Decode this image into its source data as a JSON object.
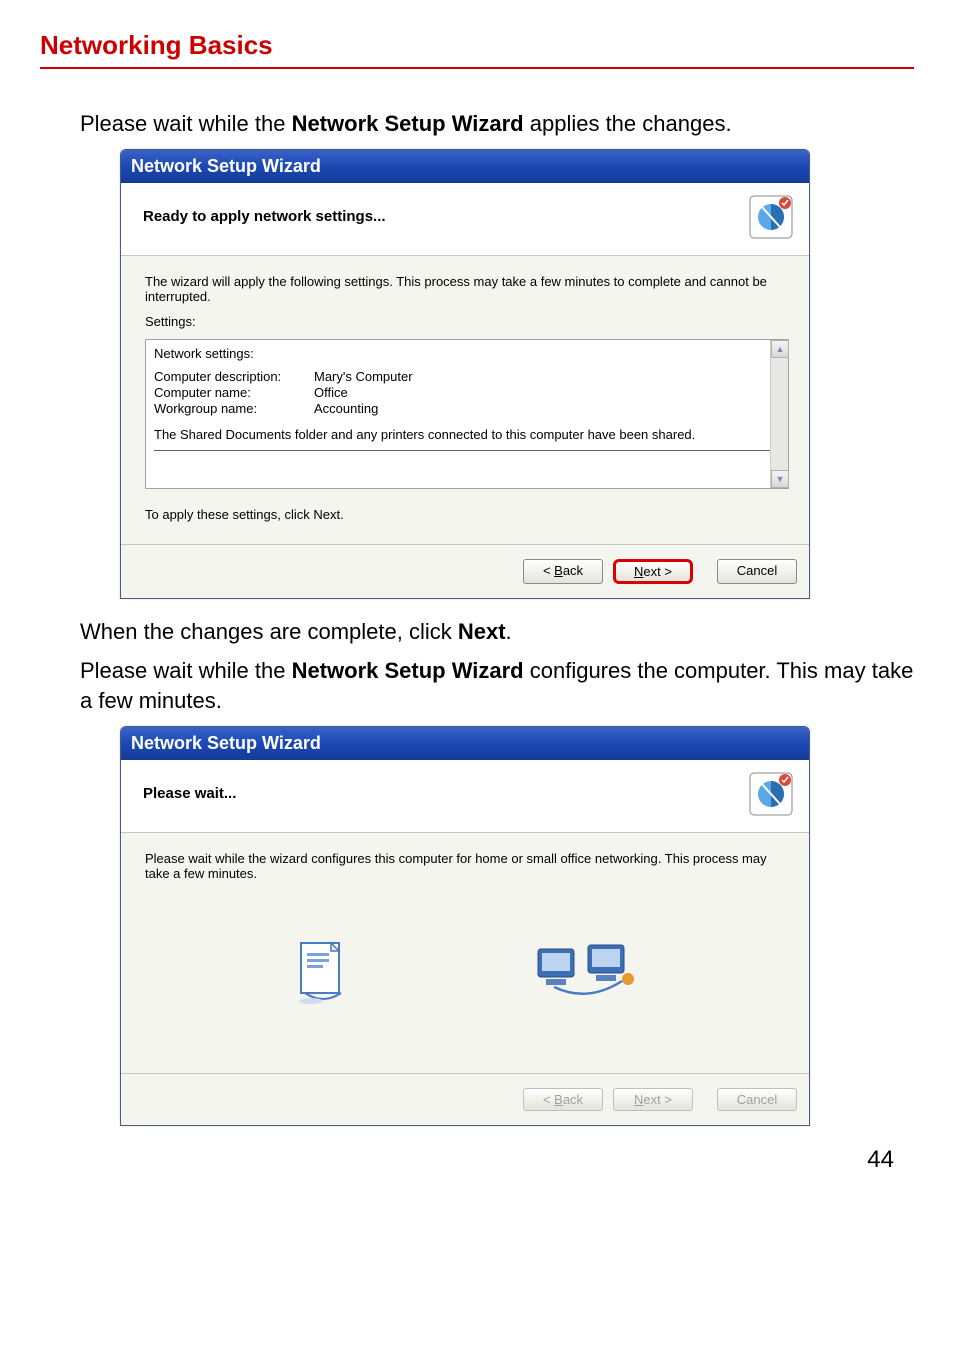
{
  "page": {
    "heading": "Networking Basics",
    "page_number": "44"
  },
  "paragraphs": {
    "p1_pre": "Please wait while the ",
    "p1_bold": "Network Setup Wizard",
    "p1_post": " applies the changes.",
    "p2_pre": "When the changes are complete, click ",
    "p2_bold": "Next",
    "p2_post": ".",
    "p3_pre": "Please wait while the ",
    "p3_bold": "Network Setup Wizard",
    "p3_post": " configures the computer. This may take a few minutes."
  },
  "wizard1": {
    "title": "Network Setup Wizard",
    "header": "Ready to apply network settings...",
    "intro": "The wizard will apply the following settings. This process may take a few minutes to complete and cannot be interrupted.",
    "settings_label": "Settings:",
    "settings": {
      "section_title": "Network settings:",
      "rows": [
        {
          "label": "Computer description:",
          "value": "Mary's Computer"
        },
        {
          "label": "Computer name:",
          "value": "Office"
        },
        {
          "label": "Workgroup name:",
          "value": "Accounting"
        }
      ],
      "shared_text": "The Shared Documents folder and any printers connected to this computer have been shared."
    },
    "apply_text": "To apply these settings, click Next.",
    "buttons": {
      "back_prefix": "< ",
      "back_u": "B",
      "back_rest": "ack",
      "next_u": "N",
      "next_rest": "ext >",
      "cancel": "Cancel"
    }
  },
  "wizard2": {
    "title": "Network Setup Wizard",
    "header": "Please wait...",
    "intro": "Please wait while the wizard configures this computer for home or small office networking. This process may take a few minutes.",
    "buttons": {
      "back_prefix": "< ",
      "back_u": "B",
      "back_rest": "ack",
      "next_u": "N",
      "next_rest": "ext >",
      "cancel": "Cancel"
    }
  }
}
